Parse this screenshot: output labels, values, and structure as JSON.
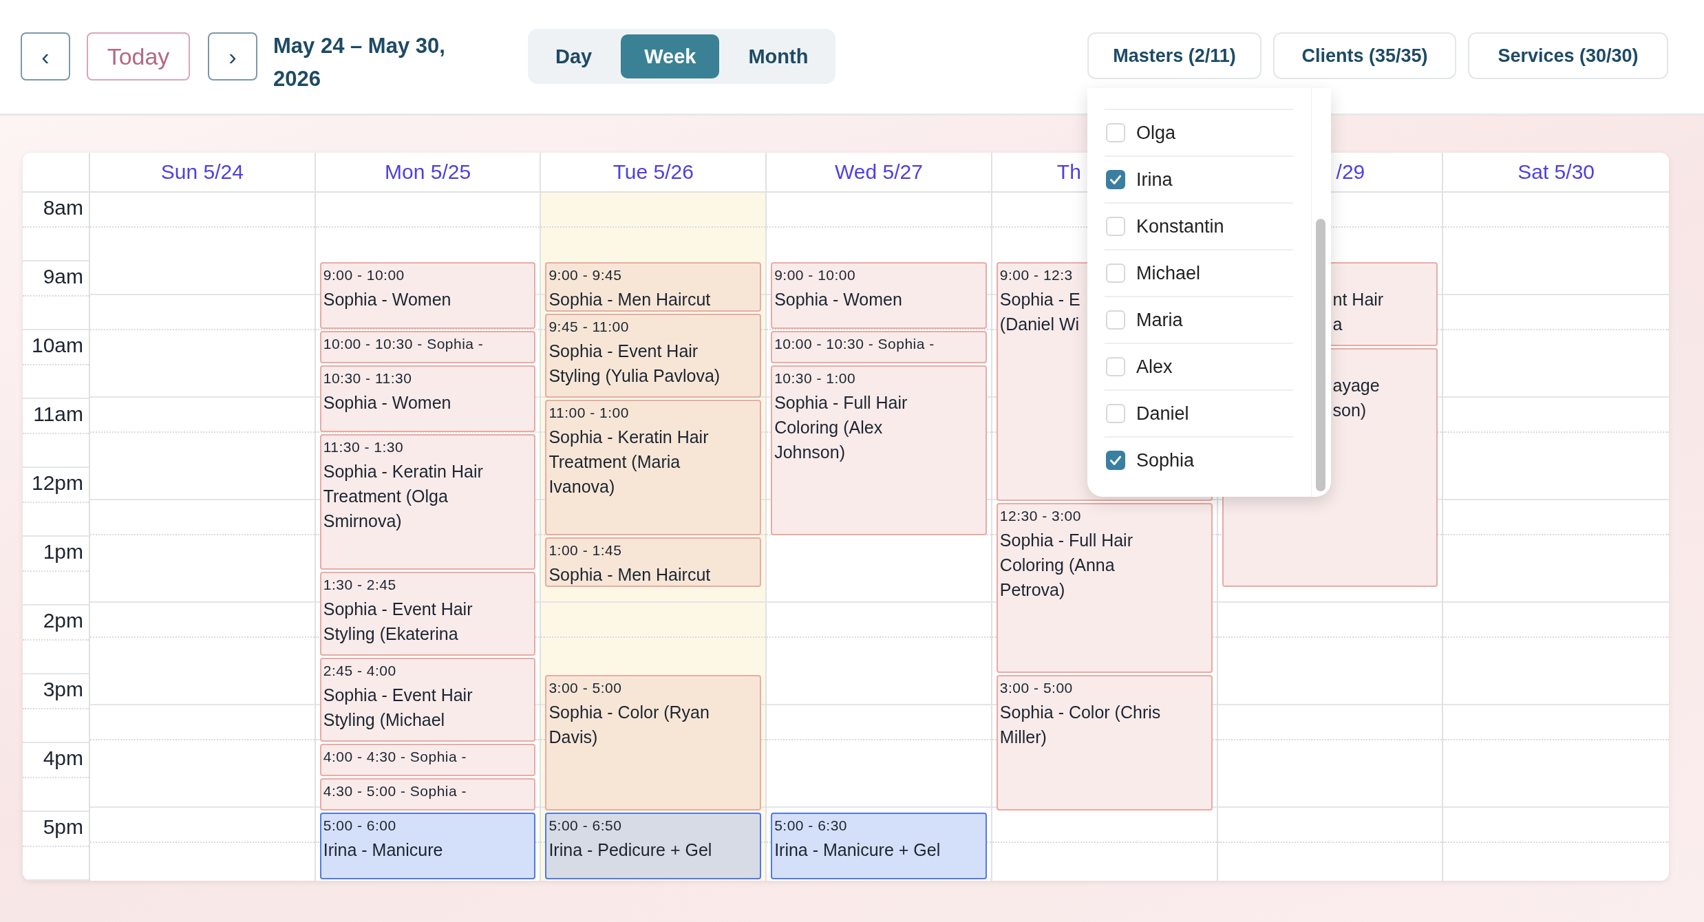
{
  "toolbar": {
    "previous": "‹",
    "today": "Today",
    "next": "›",
    "range": "May 24 – May 30, 2026"
  },
  "views": [
    {
      "label": "Day",
      "selected": false
    },
    {
      "label": "Week",
      "selected": true
    },
    {
      "label": "Month",
      "selected": false
    }
  ],
  "filters": [
    {
      "label": "Masters (2/11)"
    },
    {
      "label": "Clients (35/35)"
    },
    {
      "label": "Services (30/30)"
    }
  ],
  "masters_dropdown": {
    "items": [
      {
        "label": "Olga",
        "checked": false
      },
      {
        "label": "Irina",
        "checked": true
      },
      {
        "label": "Konstantin",
        "checked": false
      },
      {
        "label": "Michael",
        "checked": false
      },
      {
        "label": "Maria",
        "checked": false
      },
      {
        "label": "Alex",
        "checked": false
      },
      {
        "label": "Daniel",
        "checked": false
      },
      {
        "label": "Sophia",
        "checked": true
      }
    ]
  },
  "calendar": {
    "hours": [
      "8am",
      "9am",
      "10am",
      "11am",
      "12pm",
      "1pm",
      "2pm",
      "3pm",
      "4pm",
      "5pm"
    ],
    "days": [
      {
        "label": "Sun 5/24",
        "today": false
      },
      {
        "label": "Mon 5/25",
        "today": false,
        "events": [
          {
            "time": "9:00 - 10:00",
            "lines": [
              "Sophia - Women"
            ],
            "kind": "hair",
            "color": "#f8ebea"
          },
          {
            "time": "10:00 - 10:30 - Sophia -",
            "kind": "hair",
            "color": "#f8ebea"
          },
          {
            "time": "10:30 - 11:30",
            "lines": [
              "Sophia - Women"
            ],
            "kind": "hair",
            "color": "#f8ebea"
          },
          {
            "time": "11:30 - 1:30",
            "lines": [
              "Sophia - Keratin Hair",
              "Treatment (Olga",
              "Smirnova)"
            ],
            "kind": "hair",
            "color": "#f8ebea"
          },
          {
            "time": "1:30 - 2:45",
            "lines": [
              "Sophia - Event Hair",
              "Styling (Ekaterina"
            ],
            "kind": "hair",
            "color": "#f8ebea"
          },
          {
            "time": "2:45 - 4:00",
            "lines": [
              "Sophia - Event Hair",
              "Styling (Michael"
            ],
            "kind": "hair",
            "color": "#f8ebea"
          },
          {
            "time": "4:00 - 4:30 - Sophia -",
            "kind": "hair",
            "color": "#f8ebea"
          },
          {
            "time": "4:30 - 5:00 - Sophia -",
            "kind": "hair",
            "color": "#f8ebea"
          },
          {
            "time": "5:00 - 6:00",
            "lines": [
              "Irina - Manicure"
            ],
            "kind": "nails",
            "color": "#d4dff9"
          }
        ]
      },
      {
        "label": "Tue 5/26",
        "today": true,
        "events": [
          {
            "time": "9:00 - 9:45",
            "lines": [
              "Sophia - Men Haircut"
            ],
            "kind": "hair",
            "color": "#f7e6d6"
          },
          {
            "time": "9:45 - 11:00",
            "lines": [
              "Sophia - Event Hair",
              "Styling (Yulia Pavlova)"
            ],
            "kind": "hair",
            "color": "#f7e6d6"
          },
          {
            "time": "11:00 - 1:00",
            "lines": [
              "Sophia - Keratin Hair",
              "Treatment (Maria",
              "Ivanova)"
            ],
            "kind": "hair",
            "color": "#f7e6d6"
          },
          {
            "time": "1:00 - 1:45",
            "lines": [
              "Sophia - Men Haircut"
            ],
            "kind": "hair",
            "color": "#f7e6d6"
          },
          {
            "time": "3:00 - 5:00",
            "lines": [
              "Sophia - Color (Ryan",
              "Davis)"
            ],
            "kind": "hair",
            "color": "#f7e6d6"
          },
          {
            "time": "5:00 - 6:50",
            "lines": [
              "Irina - Pedicure + Gel"
            ],
            "kind": "nails",
            "color": "#d6dbe6"
          }
        ]
      },
      {
        "label": "Wed 5/27",
        "today": false,
        "events": [
          {
            "time": "9:00 - 10:00",
            "lines": [
              "Sophia - Women"
            ],
            "kind": "hair",
            "color": "#f8ebea"
          },
          {
            "time": "10:00 - 10:30 - Sophia -",
            "kind": "hair",
            "color": "#f8ebea"
          },
          {
            "time": "10:30 - 1:00",
            "lines": [
              "Sophia - Full Hair",
              "Coloring (Alex",
              "Johnson)"
            ],
            "kind": "hair",
            "color": "#f8ebea"
          },
          {
            "time": "5:00 - 6:30",
            "lines": [
              "Irina - Manicure + Gel"
            ],
            "kind": "nails",
            "color": "#d4dff9"
          }
        ]
      },
      {
        "label": "Th",
        "today": false,
        "events": [
          {
            "time": "9:00 - 12:3",
            "lines": [
              "Sophia - E",
              "(Daniel Wi"
            ],
            "kind": "hair",
            "color": "#f8ebea"
          },
          {
            "time": "12:30 - 3:00",
            "lines": [
              "Sophia - Full Hair",
              "Coloring (Anna",
              "Petrova)"
            ],
            "kind": "hair",
            "color": "#f8ebea"
          },
          {
            "time": "3:00 - 5:00",
            "lines": [
              "Sophia - Color (Chris",
              "Miller)"
            ],
            "kind": "hair",
            "color": "#f8ebea"
          }
        ]
      },
      {
        "label": "/29",
        "today": false,
        "events": [
          {
            "lines": [
              "nt Hair",
              "a"
            ],
            "kind": "hair",
            "color": "#f8ebea"
          },
          {
            "lines": [
              "ayage",
              "son)"
            ],
            "kind": "hair",
            "color": "#f8ebea"
          }
        ]
      },
      {
        "label": "Sat 5/30",
        "today": false
      }
    ]
  }
}
